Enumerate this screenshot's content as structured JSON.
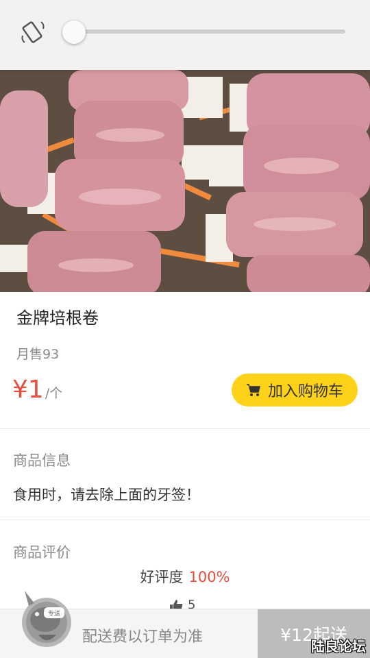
{
  "product": {
    "name": "金牌培根卷",
    "monthly_sales": "月售93",
    "price": "¥1",
    "unit": "/个",
    "add_to_cart_label": "加入购物车"
  },
  "info_section": {
    "title": "商品信息",
    "text": "食用时，请去除上面的牙签！"
  },
  "reviews_section": {
    "title": "商品评价",
    "rating_label": "好评度",
    "rating_value": "100%",
    "thumbs_up_count": "5"
  },
  "bottom_bar": {
    "mascot_badge": "专送",
    "delivery_note": "配送费以订单为准",
    "min_order": "¥12起送"
  },
  "watermark": "陆良论坛",
  "brightness_slider": {
    "level": 0.02
  },
  "colors": {
    "accent_yellow": "#ffd21a",
    "price_red": "#e74c3c",
    "min_order_bg": "#bcbcbc"
  },
  "icons": [
    "rotate-icon",
    "cart-icon",
    "thumbs-up-icon",
    "mascot-icon"
  ]
}
